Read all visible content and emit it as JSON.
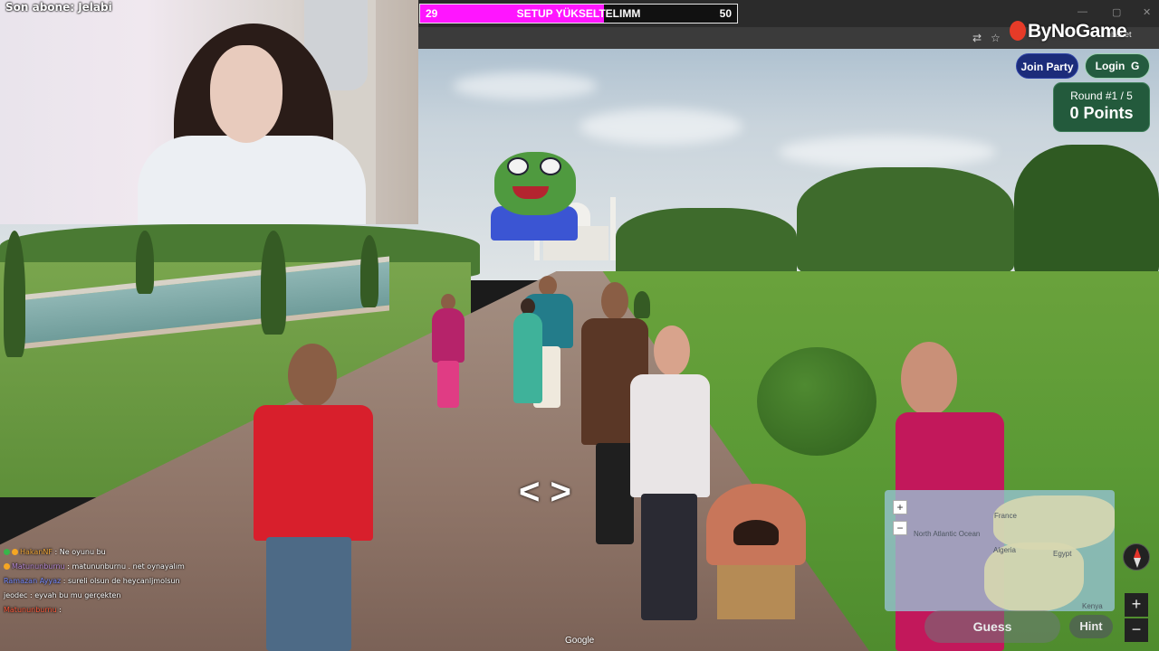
{
  "stream": {
    "latest_sub": "Son abone: Jelabi",
    "goal": {
      "title": "SETUP YÜKSELTELIMM",
      "current": "29",
      "target": "50",
      "progress": 0.58,
      "fill_color": "#ff15ff"
    },
    "chat": [
      {
        "user": "HakanNF",
        "message": ": Ne oyunu bu",
        "user_color": "#f2a93b"
      },
      {
        "user": "Matununburnu",
        "message": ": matununburnu . net oynayalım",
        "user_color": "#b98ad8"
      },
      {
        "user": "Ramazan Ayyaz",
        "message": ": sureli olsun de heycanljmolsun",
        "user_color": "#7a8cff"
      },
      {
        "user": "jeodec",
        "message": ": eyvah bu mu gerçekten",
        "user_color": "#ffffff"
      },
      {
        "user": "Matununburnu",
        "message": ":",
        "user_color": "#ff5a3c"
      }
    ]
  },
  "browser": {
    "tab_partial": "hbet et",
    "window_controls": [
      "—",
      "▢",
      "✕"
    ]
  },
  "brand": {
    "name": "ByNoGame",
    "accent": "#e63b28"
  },
  "game": {
    "join_party_label": "Join Party",
    "login_label": "Login",
    "round_label": "Round #1 / 5",
    "points_label": "0 Points",
    "guess_label": "Guess",
    "hint_label": "Hint",
    "zoom_in": "+",
    "zoom_out": "−",
    "map_labels": {
      "north_atlantic": "North Atlantic Ocean",
      "egypt": "Egypt",
      "algeria": "Algeria",
      "france": "France",
      "kenya": "Kenya"
    },
    "colors": {
      "join": "#1c2c7a",
      "login": "#245b3f",
      "card": "#235a3c"
    }
  },
  "streetview": {
    "watermark": "Google",
    "move_arrows": "< >",
    "icons": [
      "compass-icon",
      "zoom-in-icon",
      "zoom-out-icon"
    ]
  }
}
